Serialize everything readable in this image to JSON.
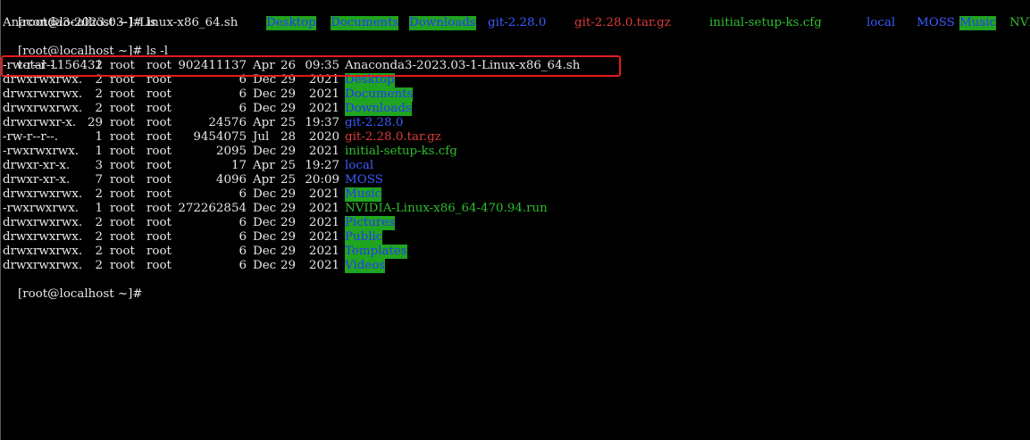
{
  "prompt1": {
    "text": "[root@localhost ~]# ls"
  },
  "ls_items": [
    {
      "name": "Anaconda3-2023.03-1-Linux-x86_64.sh",
      "style": "white"
    },
    {
      "name": "Desktop",
      "style": "hl"
    },
    {
      "name": "Documents",
      "style": "hl"
    },
    {
      "name": "Downloads",
      "style": "hl"
    },
    {
      "name": "git-2.28.0",
      "style": "blue"
    },
    {
      "name": "git-2.28.0.tar.gz",
      "style": "red"
    },
    {
      "name": "initial-setup-ks.cfg",
      "style": "green"
    },
    {
      "name": "local",
      "style": "blue"
    },
    {
      "name": "MOSS",
      "style": "blue"
    },
    {
      "name": "Music",
      "style": "hl"
    },
    {
      "name": "NVI",
      "style": "green"
    }
  ],
  "prompt2": {
    "text": "[root@localhost ~]# ls -l"
  },
  "total": {
    "text": "total 1156432"
  },
  "rows": [
    {
      "perm": "-rw-r--r--.",
      "links": "1",
      "owner": "root",
      "group": "root",
      "size": "902411137",
      "month": "Apr",
      "day": "26",
      "time": "09:35",
      "name": "Anaconda3-2023.03-1-Linux-x86_64.sh",
      "style": "white"
    },
    {
      "perm": "drwxrwxrwx.",
      "links": "2",
      "owner": "root",
      "group": "root",
      "size": "6",
      "month": "Dec",
      "day": "29",
      "time": "2021",
      "name": "Desktop",
      "style": "hl"
    },
    {
      "perm": "drwxrwxrwx.",
      "links": "2",
      "owner": "root",
      "group": "root",
      "size": "6",
      "month": "Dec",
      "day": "29",
      "time": "2021",
      "name": "Documents",
      "style": "hl"
    },
    {
      "perm": "drwxrwxrwx.",
      "links": "2",
      "owner": "root",
      "group": "root",
      "size": "6",
      "month": "Dec",
      "day": "29",
      "time": "2021",
      "name": "Downloads",
      "style": "hl"
    },
    {
      "perm": "drwxrwxr-x.",
      "links": "29",
      "owner": "root",
      "group": "root",
      "size": "24576",
      "month": "Apr",
      "day": "25",
      "time": "19:37",
      "name": "git-2.28.0",
      "style": "blue"
    },
    {
      "perm": "-rw-r--r--.",
      "links": "1",
      "owner": "root",
      "group": "root",
      "size": "9454075",
      "month": "Jul",
      "day": "28",
      "time": "2020",
      "name": "git-2.28.0.tar.gz",
      "style": "red"
    },
    {
      "perm": "-rwxrwxrwx.",
      "links": "1",
      "owner": "root",
      "group": "root",
      "size": "2095",
      "month": "Dec",
      "day": "29",
      "time": "2021",
      "name": "initial-setup-ks.cfg",
      "style": "green"
    },
    {
      "perm": "drwxr-xr-x.",
      "links": "3",
      "owner": "root",
      "group": "root",
      "size": "17",
      "month": "Apr",
      "day": "25",
      "time": "19:27",
      "name": "local",
      "style": "blue"
    },
    {
      "perm": "drwxr-xr-x.",
      "links": "7",
      "owner": "root",
      "group": "root",
      "size": "4096",
      "month": "Apr",
      "day": "25",
      "time": "20:09",
      "name": "MOSS",
      "style": "blue"
    },
    {
      "perm": "drwxrwxrwx.",
      "links": "2",
      "owner": "root",
      "group": "root",
      "size": "6",
      "month": "Dec",
      "day": "29",
      "time": "2021",
      "name": "Music",
      "style": "hl"
    },
    {
      "perm": "-rwxrwxrwx.",
      "links": "1",
      "owner": "root",
      "group": "root",
      "size": "272262854",
      "month": "Dec",
      "day": "29",
      "time": "2021",
      "name": "NVIDIA-Linux-x86_64-470.94.run",
      "style": "green"
    },
    {
      "perm": "drwxrwxrwx.",
      "links": "2",
      "owner": "root",
      "group": "root",
      "size": "6",
      "month": "Dec",
      "day": "29",
      "time": "2021",
      "name": "Pictures",
      "style": "hl"
    },
    {
      "perm": "drwxrwxrwx.",
      "links": "2",
      "owner": "root",
      "group": "root",
      "size": "6",
      "month": "Dec",
      "day": "29",
      "time": "2021",
      "name": "Public",
      "style": "hl"
    },
    {
      "perm": "drwxrwxrwx.",
      "links": "2",
      "owner": "root",
      "group": "root",
      "size": "6",
      "month": "Dec",
      "day": "29",
      "time": "2021",
      "name": "Templates",
      "style": "hl"
    },
    {
      "perm": "drwxrwxrwx.",
      "links": "2",
      "owner": "root",
      "group": "root",
      "size": "6",
      "month": "Dec",
      "day": "29",
      "time": "2021",
      "name": "Videos",
      "style": "hl"
    }
  ],
  "prompt3": {
    "text": "[root@localhost ~]#"
  },
  "colors": {
    "background": "#000000",
    "text": "#e8e8e8",
    "directory_highlight_bg": "#1fa51f",
    "directory_highlight_fg": "#2a35ff",
    "link_blue": "#3b5bff",
    "archive_red": "#e03a3a",
    "executable_green": "#2ebd2e",
    "annotation_red": "#e31b1b"
  }
}
